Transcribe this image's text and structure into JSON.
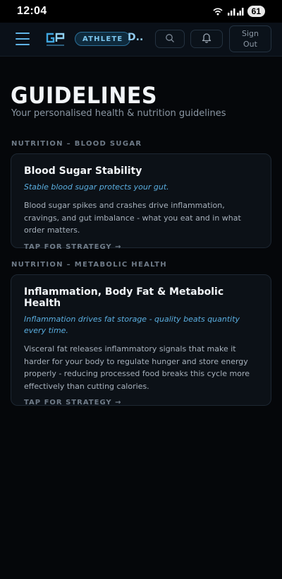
{
  "status_bar": {
    "time": "12:04",
    "battery": "61",
    "icons": [
      "hotspot-icon",
      "signal-icon",
      "battery-icon"
    ]
  },
  "header": {
    "menu_icon": "hamburger-menu-icon",
    "logo_icon": "gp-logo-icon",
    "role_badge": "ATHLETE",
    "title_truncated": "D...",
    "search_icon": "search-icon",
    "notifications_icon": "bell-icon",
    "sign_out_label": "Sign Out",
    "accent_color": "#5fb3e6"
  },
  "page": {
    "title": "GUIDELINES",
    "subtitle": "Your personalised health & nutrition guidelines"
  },
  "sections": [
    {
      "label": "NUTRITION – BLOOD SUGAR",
      "card": {
        "title": "Blood Sugar Stability",
        "tagline": "Stable blood sugar protects your gut.",
        "body": "Blood sugar spikes and crashes drive inflammation, cravings, and gut imbalance - what you eat and in what order matters.",
        "cta": "TAP FOR STRATEGY →"
      }
    },
    {
      "label": "NUTRITION – METABOLIC HEALTH",
      "card": {
        "title": "Inflammation, Body Fat & Metabolic Health",
        "tagline": "Inflammation drives fat storage - quality beats quantity every time.",
        "body": "Visceral fat releases inflammatory signals that make it harder for your body to regulate hunger and store energy properly - reducing processed food breaks this cycle more effectively than cutting calories.",
        "cta": "TAP FOR STRATEGY →"
      }
    }
  ]
}
